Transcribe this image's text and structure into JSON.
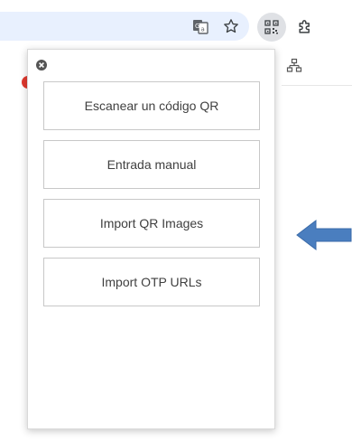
{
  "toolbar": {
    "icons": [
      "translate-icon",
      "star-icon",
      "qr-extension-icon",
      "puzzle-icon"
    ]
  },
  "popup": {
    "buttons": [
      {
        "label": "Escanear un código QR"
      },
      {
        "label": "Entrada manual"
      },
      {
        "label": "Import QR Images"
      },
      {
        "label": "Import OTP URLs"
      }
    ]
  },
  "colors": {
    "omnibox": "#e8f0fe",
    "arrow": "#4a7ebf",
    "badge": "#e0392f"
  }
}
